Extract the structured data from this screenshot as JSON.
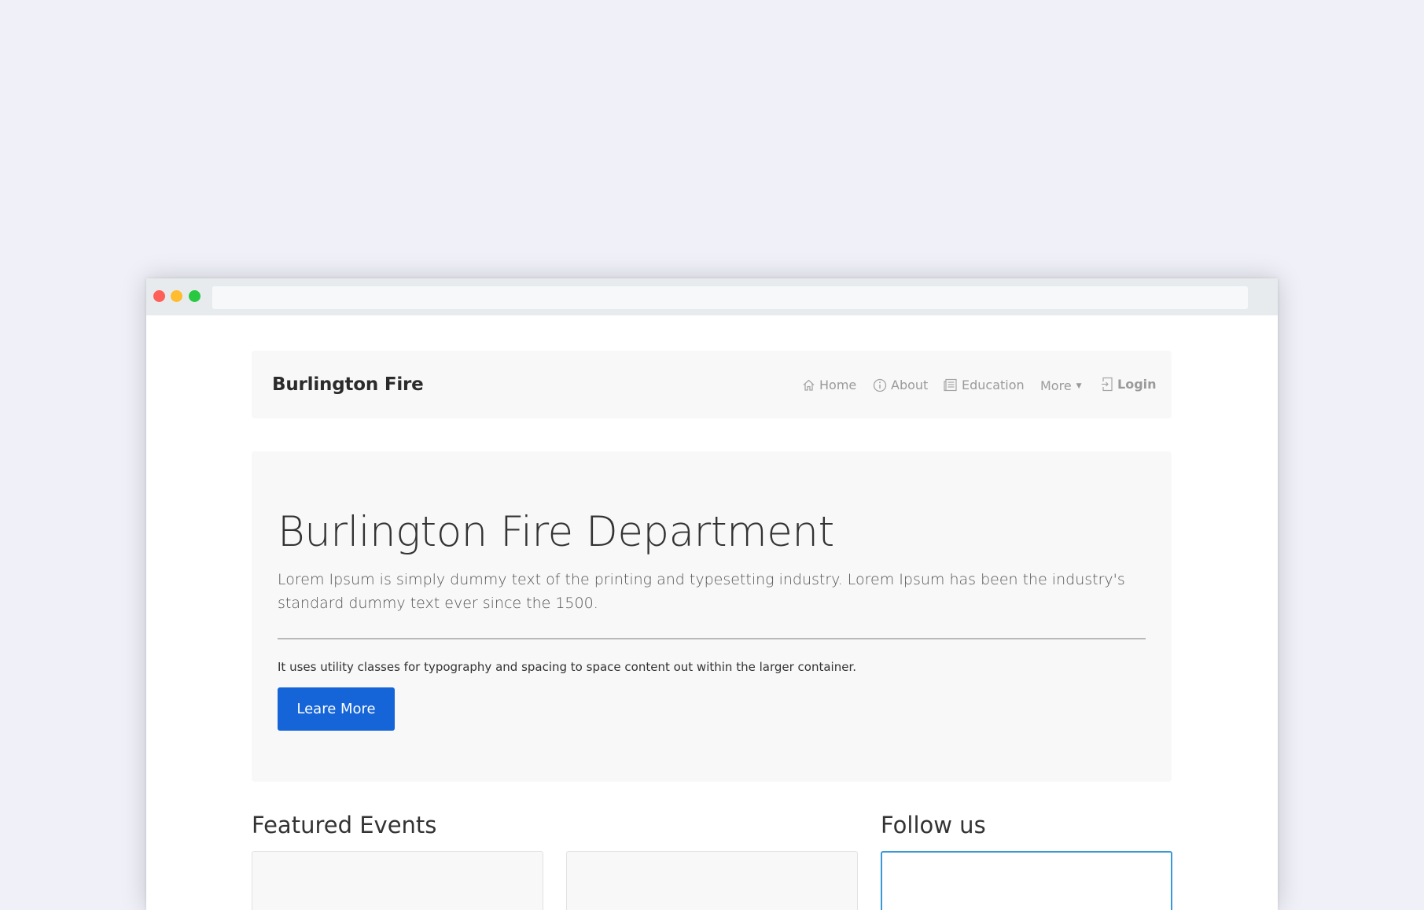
{
  "navbar": {
    "brand": "Burlington Fire",
    "items": [
      {
        "label": "Home",
        "icon": "home-icon"
      },
      {
        "label": "About",
        "icon": "info-icon"
      },
      {
        "label": "Education",
        "icon": "newspaper-icon"
      },
      {
        "label": "More",
        "icon": "caret-down-icon"
      },
      {
        "label": "Login",
        "icon": "login-icon"
      }
    ]
  },
  "jumbotron": {
    "title": "Burlington Fire Department",
    "lead": "Lorem Ipsum is simply dummy text of the printing and typesetting industry. Lorem Ipsum has been the industry's standard dummy text ever since the 1500.",
    "note": "It uses utility classes for typography and spacing to space content out within the larger container.",
    "button_label": "Leare More"
  },
  "sections": {
    "featured_title": "Featured Events",
    "follow_title": "Follow us"
  },
  "colors": {
    "primary_button": "#1565d8",
    "follow_border": "#3a98d8",
    "page_background": "#eff0f8"
  }
}
